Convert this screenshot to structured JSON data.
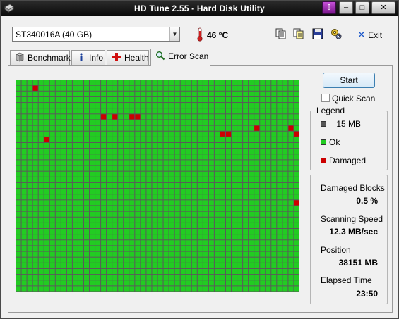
{
  "window": {
    "title": "HD Tune 2.55 - Hard Disk Utility",
    "buttons": {
      "minimize": "‒",
      "maximize": "□",
      "close": "✕",
      "download": "⇩"
    }
  },
  "toolbar": {
    "drive": "ST340016A (40 GB)",
    "temperature": "46 °C",
    "exit_label": "Exit",
    "icons": [
      "copy-icon",
      "copy-info-icon",
      "save-icon",
      "options-icon",
      "exit-icon",
      "thermometer-icon"
    ]
  },
  "tabs": [
    {
      "label": "Benchmark",
      "icon": "benchmark-icon",
      "active": false
    },
    {
      "label": "Info",
      "icon": "info-icon",
      "active": false
    },
    {
      "label": "Health",
      "icon": "health-cross-icon",
      "active": false
    },
    {
      "label": "Error Scan",
      "icon": "magnifier-icon",
      "active": true
    }
  ],
  "scan": {
    "start_label": "Start",
    "quick_scan_label": "Quick Scan",
    "quick_scan_checked": false,
    "legend": {
      "title": "Legend",
      "block_size": "= 15 MB",
      "ok": "Ok",
      "damaged": "Damaged"
    },
    "stats": {
      "damaged_blocks_label": "Damaged Blocks",
      "damaged_blocks_value": "0.5 %",
      "scanning_speed_label": "Scanning Speed",
      "scanning_speed_value": "12.3 MB/sec",
      "position_label": "Position",
      "position_value": "38151 MB",
      "elapsed_label": "Elapsed Time",
      "elapsed_value": "23:50"
    },
    "grid": {
      "columns": 50,
      "rows": 37,
      "ok_color": "#22cc22",
      "damaged_color": "#cc0000",
      "line_color": "#5a5a5a",
      "damaged_cells": [
        [
          3,
          1
        ],
        [
          15,
          6
        ],
        [
          17,
          6
        ],
        [
          20,
          6
        ],
        [
          21,
          6
        ],
        [
          36,
          9
        ],
        [
          37,
          9
        ],
        [
          42,
          8
        ],
        [
          48,
          8
        ],
        [
          49,
          9
        ],
        [
          5,
          10
        ],
        [
          49,
          21
        ]
      ]
    }
  },
  "colors": {
    "ok": "#22cc22",
    "damaged": "#cc0000",
    "block": "#555555",
    "title_bar": "#1a1a1a"
  }
}
